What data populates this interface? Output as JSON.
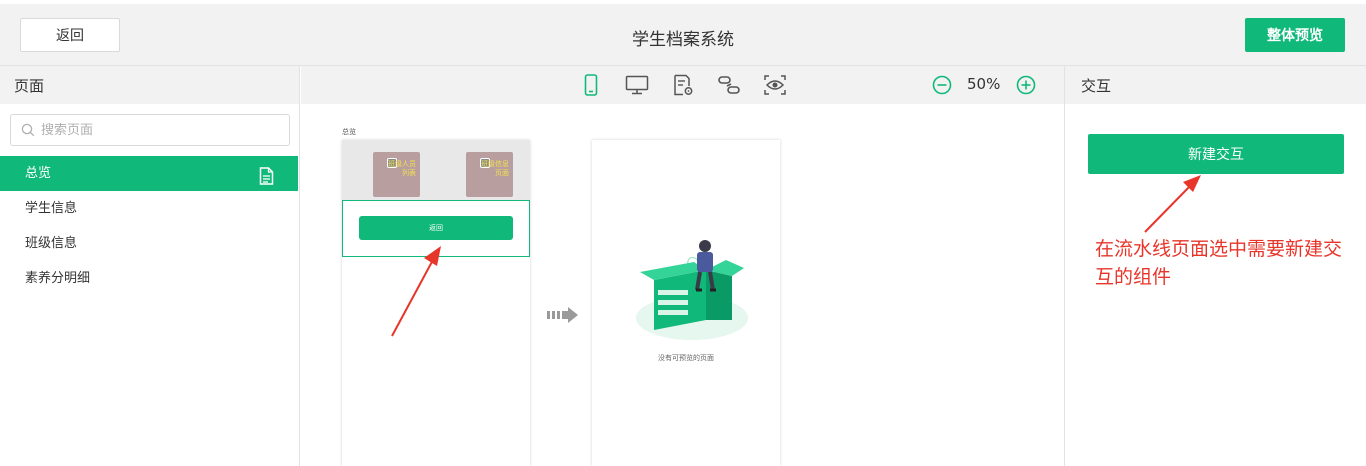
{
  "header": {
    "back_label": "返回",
    "title": "学生档案系统",
    "preview_label": "整体预览"
  },
  "left_panel": {
    "title": "页面",
    "search_placeholder": "搜索页面",
    "pages": [
      {
        "label": "总览",
        "active": true
      },
      {
        "label": "学生信息",
        "active": false
      },
      {
        "label": "班级信息",
        "active": false
      },
      {
        "label": "素养分明细",
        "active": false
      }
    ]
  },
  "toolbar": {
    "icons": [
      "mobile-icon",
      "desktop-icon",
      "page-settings-icon",
      "link-icon",
      "preview-eye-icon"
    ],
    "zoom": "50%"
  },
  "canvas": {
    "screen_label": "总览",
    "tiles": [
      {
        "text": "班级人员列表"
      },
      {
        "text": "班级信息页面"
      }
    ],
    "inner_button_label": "返回",
    "empty_text": "没有可预览的页面"
  },
  "right_panel": {
    "title": "交互",
    "new_button_label": "新建交互"
  },
  "annotation": {
    "text": "在流水线页面选中需要新建交互的组件",
    "color": "#e8352a"
  },
  "colors": {
    "accent": "#10b97a",
    "panel_bg": "#f2f2f2"
  }
}
